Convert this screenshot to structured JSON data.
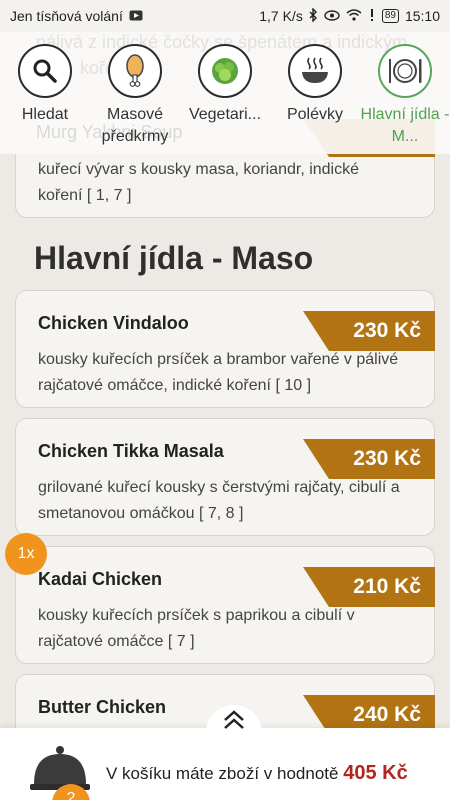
{
  "status_bar": {
    "left_text": "Jen tísňová volání",
    "speed": "1,7 K/s",
    "battery": "89",
    "time": "15:10"
  },
  "top_nav": {
    "background_text_1": "pálivá z indické čočky se špenátem a indickým",
    "background_text_2": "kořením",
    "background_text_3": "Murg Yakhni Soup",
    "items": [
      {
        "label": "Hledat",
        "icon": "search-icon"
      },
      {
        "label": "Masové předkrmy",
        "icon": "drumstick-icon"
      },
      {
        "label": "Vegetari...",
        "icon": "vegetable-icon"
      },
      {
        "label": "Polévky",
        "icon": "soup-bowl-icon"
      },
      {
        "label": "Hlavní jídla - M...",
        "icon": "plate-cutlery-icon",
        "active": true
      }
    ]
  },
  "prev_card": {
    "desc": "kuřecí vývar s kousky masa, koriandr, indické koření [ 1, 7 ]"
  },
  "section_title": "Hlavní jídla - Maso",
  "items": [
    {
      "name": "Chicken Vindaloo",
      "price": "230 Kč",
      "desc": "kousky kuřecích prsíček a brambor vařené v pálivé rajčatové omáčce, indické koření [ 10 ]"
    },
    {
      "name": "Chicken Tikka Masala",
      "price": "230 Kč",
      "desc": "grilované kuřecí kousky s čerstvými rajčaty, cibulí a smetanovou omáčkou [ 7, 8 ]"
    },
    {
      "name": "Kadai Chicken",
      "price": "210 Kč",
      "desc": "kousky kuřecích prsíček s paprikou a cibulí v rajčatové omáčce [ 7 ]",
      "quantity": "1x"
    },
    {
      "name": "Butter Chicken",
      "price": "240 Kč",
      "desc": ""
    }
  ],
  "cart": {
    "text": "V košíku máte zboží v hodnotě",
    "total": "405 Kč",
    "count": "2"
  },
  "colors": {
    "accent_green": "#4fa24f",
    "price_brown": "#b27412",
    "badge_orange": "#f0941d",
    "total_red": "#b3261e"
  }
}
